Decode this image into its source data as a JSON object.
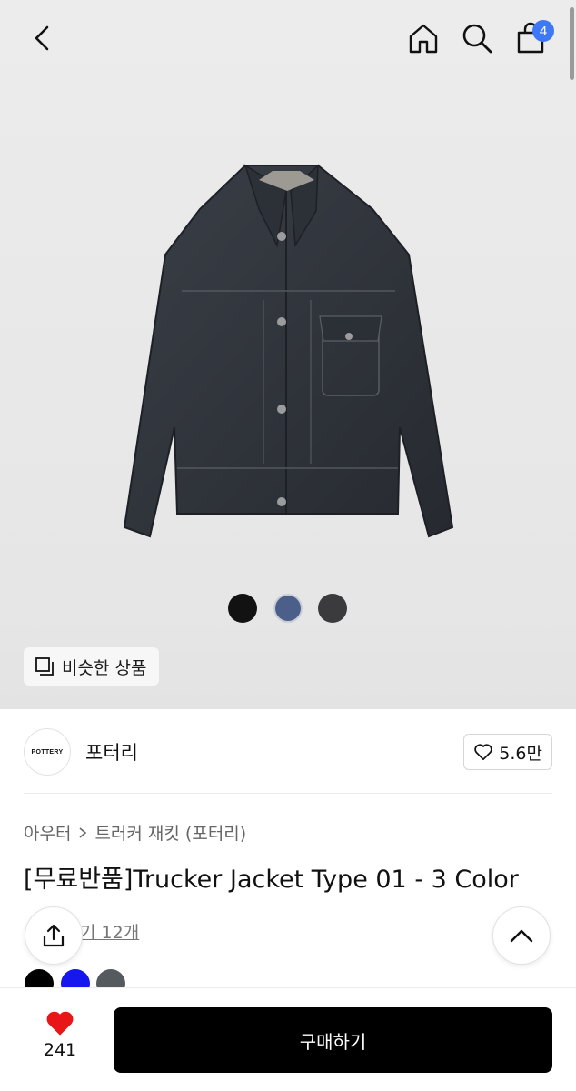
{
  "header": {
    "cart_count": "4"
  },
  "gallery": {
    "similar_label": "비슷한 상품",
    "dots": [
      "#121212",
      "#4c5f88",
      "#3b3b3d"
    ]
  },
  "brand": {
    "logo_text": "POTTERY",
    "name": "포터리",
    "like_count": "5.6만"
  },
  "product": {
    "breadcrumb": [
      "아우터",
      "트러커 재킷 (포터리)"
    ],
    "title": "[무료반품]Trucker Jacket Type 01 - 3 Color",
    "review_link": "기 12개",
    "color_chips": [
      "#000000",
      "#1616ee",
      "#555a5f"
    ]
  },
  "bottom_bar": {
    "wish_count": "241",
    "buy_label": "구매하기"
  }
}
